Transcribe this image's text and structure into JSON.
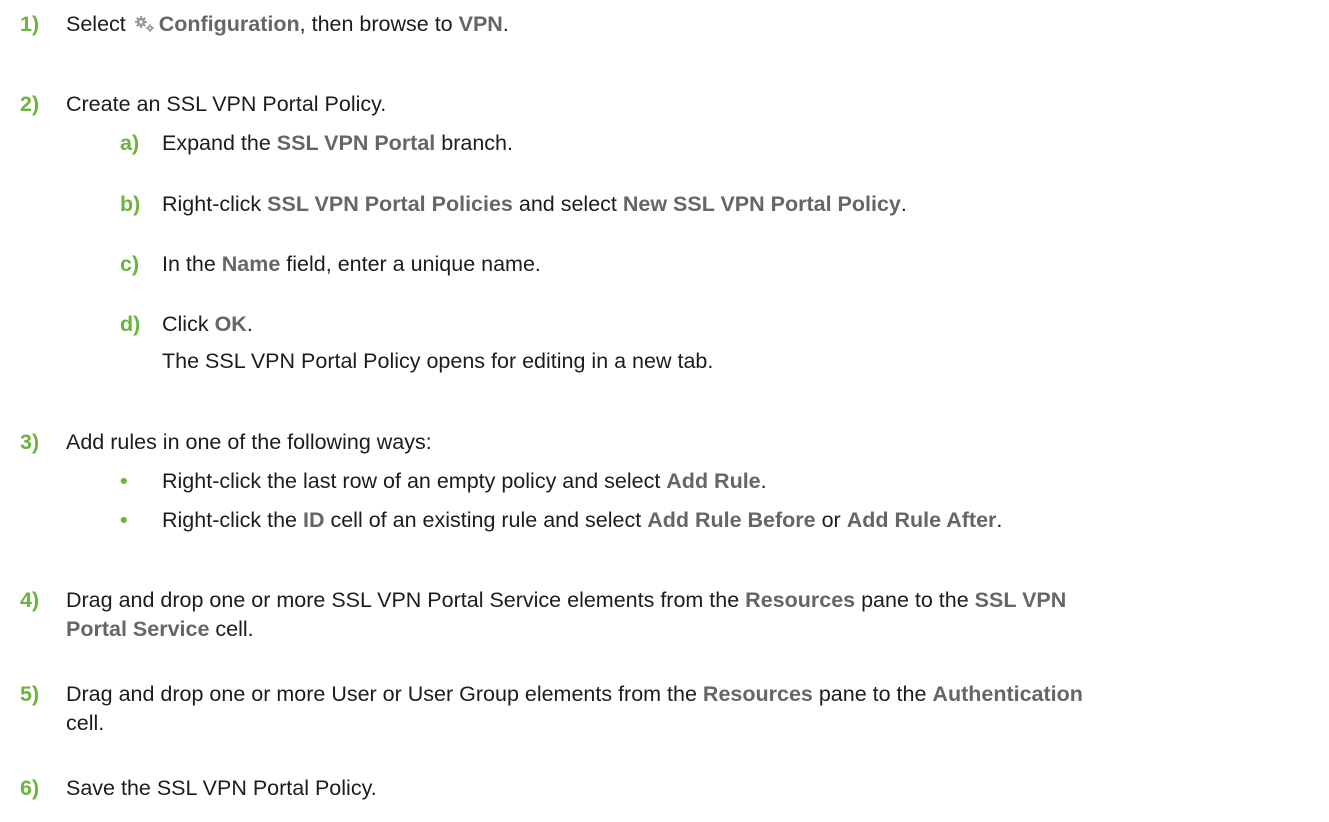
{
  "colors": {
    "accent": "#6cb33f",
    "ui_text": "#666666",
    "body_text": "#1c1c1c"
  },
  "steps": [
    {
      "number": "1)",
      "parts": [
        "Select ",
        "Configuration",
        ", then browse to ",
        "VPN",
        "."
      ],
      "icon": "gear-icon"
    },
    {
      "number": "2)",
      "text": "Create an SSL VPN Portal Policy.",
      "substeps": [
        {
          "letter": "a)",
          "parts": [
            "Expand the ",
            "SSL VPN Portal",
            " branch."
          ]
        },
        {
          "letter": "b)",
          "parts": [
            "Right-click ",
            "SSL VPN Portal Policies",
            " and select ",
            "New SSL VPN Portal Policy",
            "."
          ]
        },
        {
          "letter": "c)",
          "parts": [
            "In the ",
            "Name",
            " field, enter a unique name."
          ]
        },
        {
          "letter": "d)",
          "parts": [
            "Click ",
            "OK",
            "."
          ],
          "result": "The SSL VPN Portal Policy opens for editing in a new tab."
        }
      ]
    },
    {
      "number": "3)",
      "text": "Add rules in one of the following ways:",
      "bullet_char": "•",
      "bullets": [
        {
          "parts": [
            "Right-click the last row of an empty policy and select ",
            "Add Rule",
            "."
          ]
        },
        {
          "parts": [
            "Right-click the ",
            "ID",
            " cell of an existing rule and select ",
            "Add Rule Before",
            " or ",
            "Add Rule After",
            "."
          ]
        }
      ]
    },
    {
      "number": "4)",
      "parts": [
        "Drag and drop one or more SSL VPN Portal Service elements from the ",
        "Resources",
        " pane to the ",
        "SSL VPN",
        "Portal Service",
        " cell."
      ]
    },
    {
      "number": "5)",
      "parts": [
        "Drag and drop one or more User or User Group elements from the ",
        "Resources",
        " pane to the ",
        "Authentication",
        "cell."
      ]
    },
    {
      "number": "6)",
      "text": "Save the SSL VPN Portal Policy."
    }
  ]
}
